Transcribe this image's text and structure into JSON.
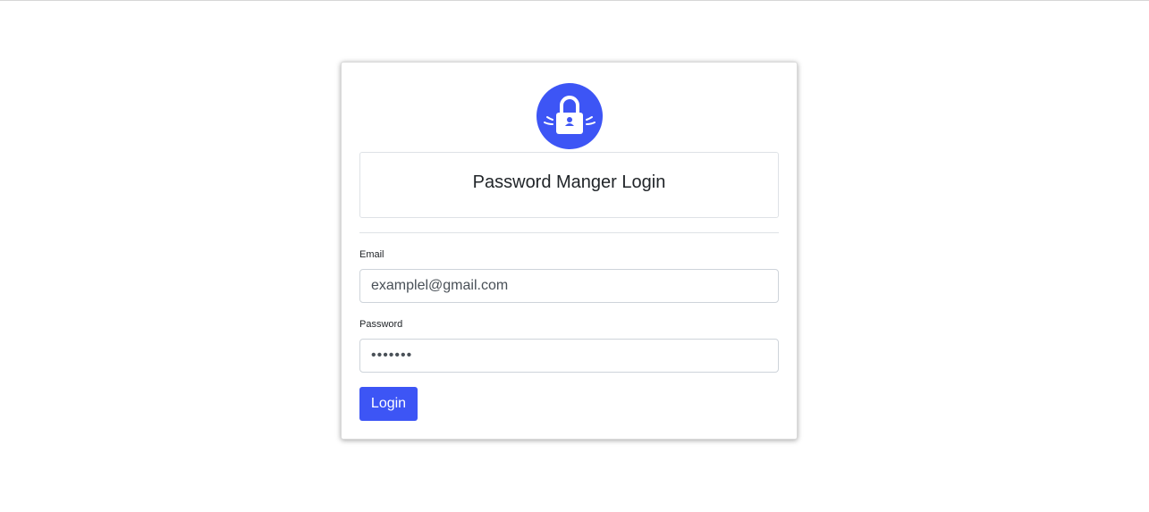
{
  "login": {
    "title": "Password Manger Login",
    "email_label": "Email",
    "email_value": "examplel@gmail.com",
    "password_label": "Password",
    "password_value": "1234567",
    "login_label": "Login"
  },
  "icons": {
    "logo": "padlock-icon"
  },
  "colors": {
    "accent": "#3d55f5",
    "border": "#ced4da"
  }
}
